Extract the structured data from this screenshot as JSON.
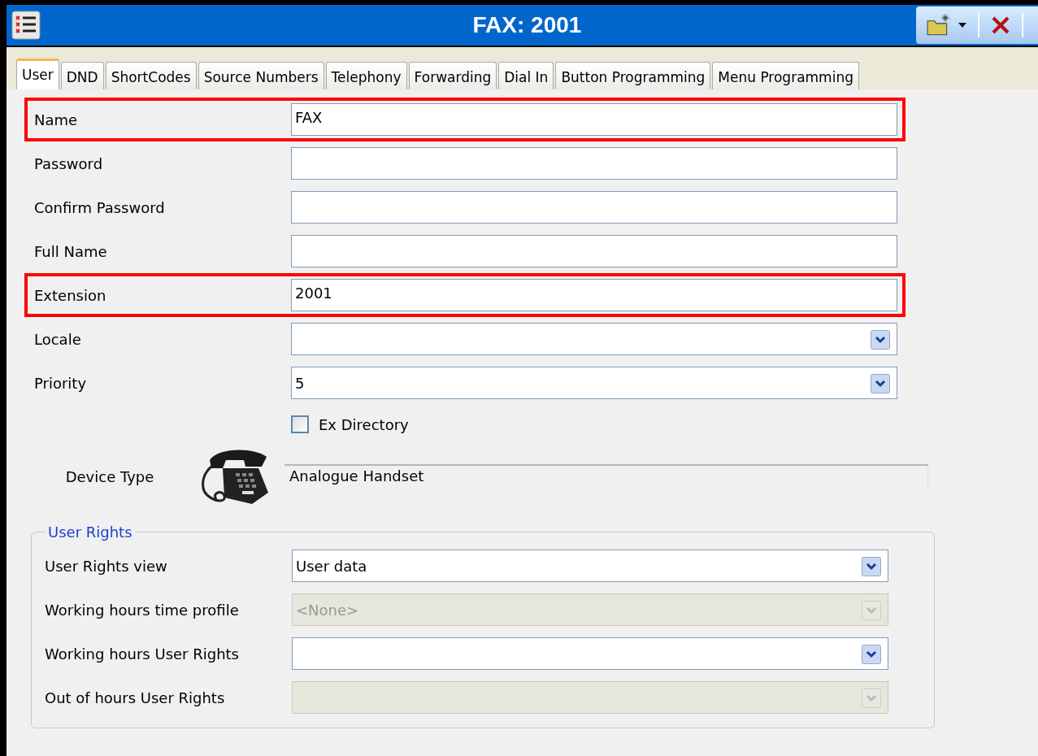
{
  "window": {
    "title": "FAX: 2001"
  },
  "tabs": [
    {
      "label": "User",
      "selected": true
    },
    {
      "label": "DND",
      "selected": false
    },
    {
      "label": "ShortCodes",
      "selected": false
    },
    {
      "label": "Source Numbers",
      "selected": false
    },
    {
      "label": "Telephony",
      "selected": false
    },
    {
      "label": "Forwarding",
      "selected": false
    },
    {
      "label": "Dial In",
      "selected": false
    },
    {
      "label": "Button Programming",
      "selected": false
    },
    {
      "label": "Menu Programming",
      "selected": false
    }
  ],
  "fields": [
    {
      "label": "Name",
      "kind": "text",
      "value": "FAX",
      "highlighted": true
    },
    {
      "label": "Password",
      "kind": "text",
      "highlighted": false
    },
    {
      "label": "Confirm Password",
      "kind": "text",
      "highlighted": false
    },
    {
      "label": "Full Name",
      "kind": "text",
      "highlighted": false
    },
    {
      "label": "Extension",
      "kind": "text",
      "value": "2001",
      "highlighted": true
    },
    {
      "label": "Locale",
      "kind": "dropdown",
      "highlighted": false
    },
    {
      "label": "Priority",
      "kind": "dropdown",
      "value": "5",
      "highlighted": false
    }
  ],
  "ex_directory": {
    "label": "Ex Directory",
    "checked": false
  },
  "device_type": {
    "label": "Device Type",
    "value": "Analogue Handset"
  },
  "user_rights": {
    "title": "User Rights",
    "fields": [
      {
        "label": "User Rights view",
        "value": "User data",
        "disabled": false
      },
      {
        "label": "Working hours time profile",
        "value": "<None>",
        "disabled": true
      },
      {
        "label": "Working hours User Rights",
        "disabled": false
      },
      {
        "label": "Out of hours User Rights",
        "disabled": true
      }
    ]
  }
}
